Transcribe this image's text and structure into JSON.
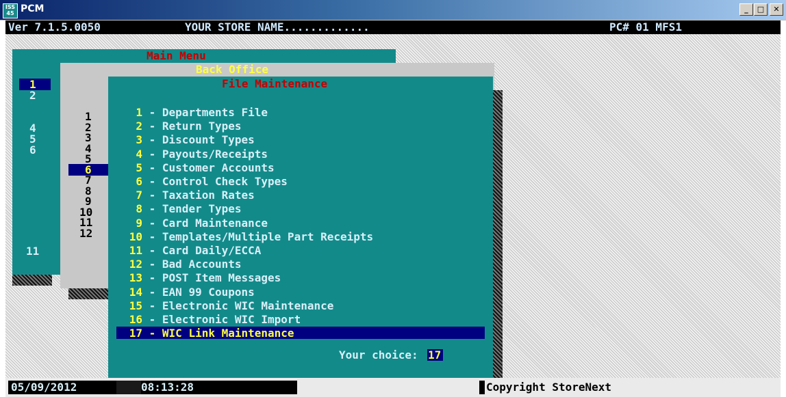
{
  "window": {
    "title": "PCM",
    "icon": "app-icon",
    "icon_text_1": "ISS",
    "icon_text_2": "45",
    "controls": {
      "minimize": "_",
      "maximize": "□",
      "close": "✕"
    }
  },
  "header": {
    "version": "Ver 7.1.5.0050",
    "store_name": "YOUR STORE NAME.............",
    "pc_id": "PC# 01 MFS1"
  },
  "main_menu": {
    "title": "Main Menu",
    "visible_numbers": [
      "1",
      "2",
      "4",
      "5",
      "6",
      "11"
    ],
    "selected": "1"
  },
  "back_office": {
    "title": "Back Office",
    "visible_numbers": [
      "1",
      "2",
      "3",
      "4",
      "5",
      "6",
      "7",
      "8",
      "9",
      "10",
      "11",
      "12"
    ],
    "selected": "6"
  },
  "file_maintenance": {
    "title": "File Maintenance",
    "items": [
      {
        "num": "1",
        "label": "Departments File"
      },
      {
        "num": "2",
        "label": "Return Types"
      },
      {
        "num": "3",
        "label": "Discount Types"
      },
      {
        "num": "4",
        "label": "Payouts/Receipts"
      },
      {
        "num": "5",
        "label": "Customer Accounts"
      },
      {
        "num": "6",
        "label": "Control Check Types"
      },
      {
        "num": "7",
        "label": "Taxation Rates"
      },
      {
        "num": "8",
        "label": "Tender Types"
      },
      {
        "num": "9",
        "label": "Card Maintenance"
      },
      {
        "num": "10",
        "label": "Templates/Multiple Part Receipts"
      },
      {
        "num": "11",
        "label": "Card Daily/ECCA"
      },
      {
        "num": "12",
        "label": "Bad Accounts"
      },
      {
        "num": "13",
        "label": "POST Item Messages"
      },
      {
        "num": "14",
        "label": "EAN 99 Coupons"
      },
      {
        "num": "15",
        "label": "Electronic WIC Maintenance"
      },
      {
        "num": "16",
        "label": "Electronic WIC Import"
      },
      {
        "num": "17",
        "label": "WIC Link Maintenance"
      }
    ],
    "selected_index": 16,
    "choice_prompt": "Your choice:",
    "choice_value": "17"
  },
  "status": {
    "date": "05/09/2012",
    "time": "08:13:28",
    "copyright": "Copyright StoreNext"
  },
  "colors": {
    "teal": "#138a8a",
    "navy": "#000080",
    "title_red": "#c40000",
    "title_yellow": "#ffff40",
    "text_light": "#d8f0f8",
    "panel_gray": "#c8c8c8"
  }
}
